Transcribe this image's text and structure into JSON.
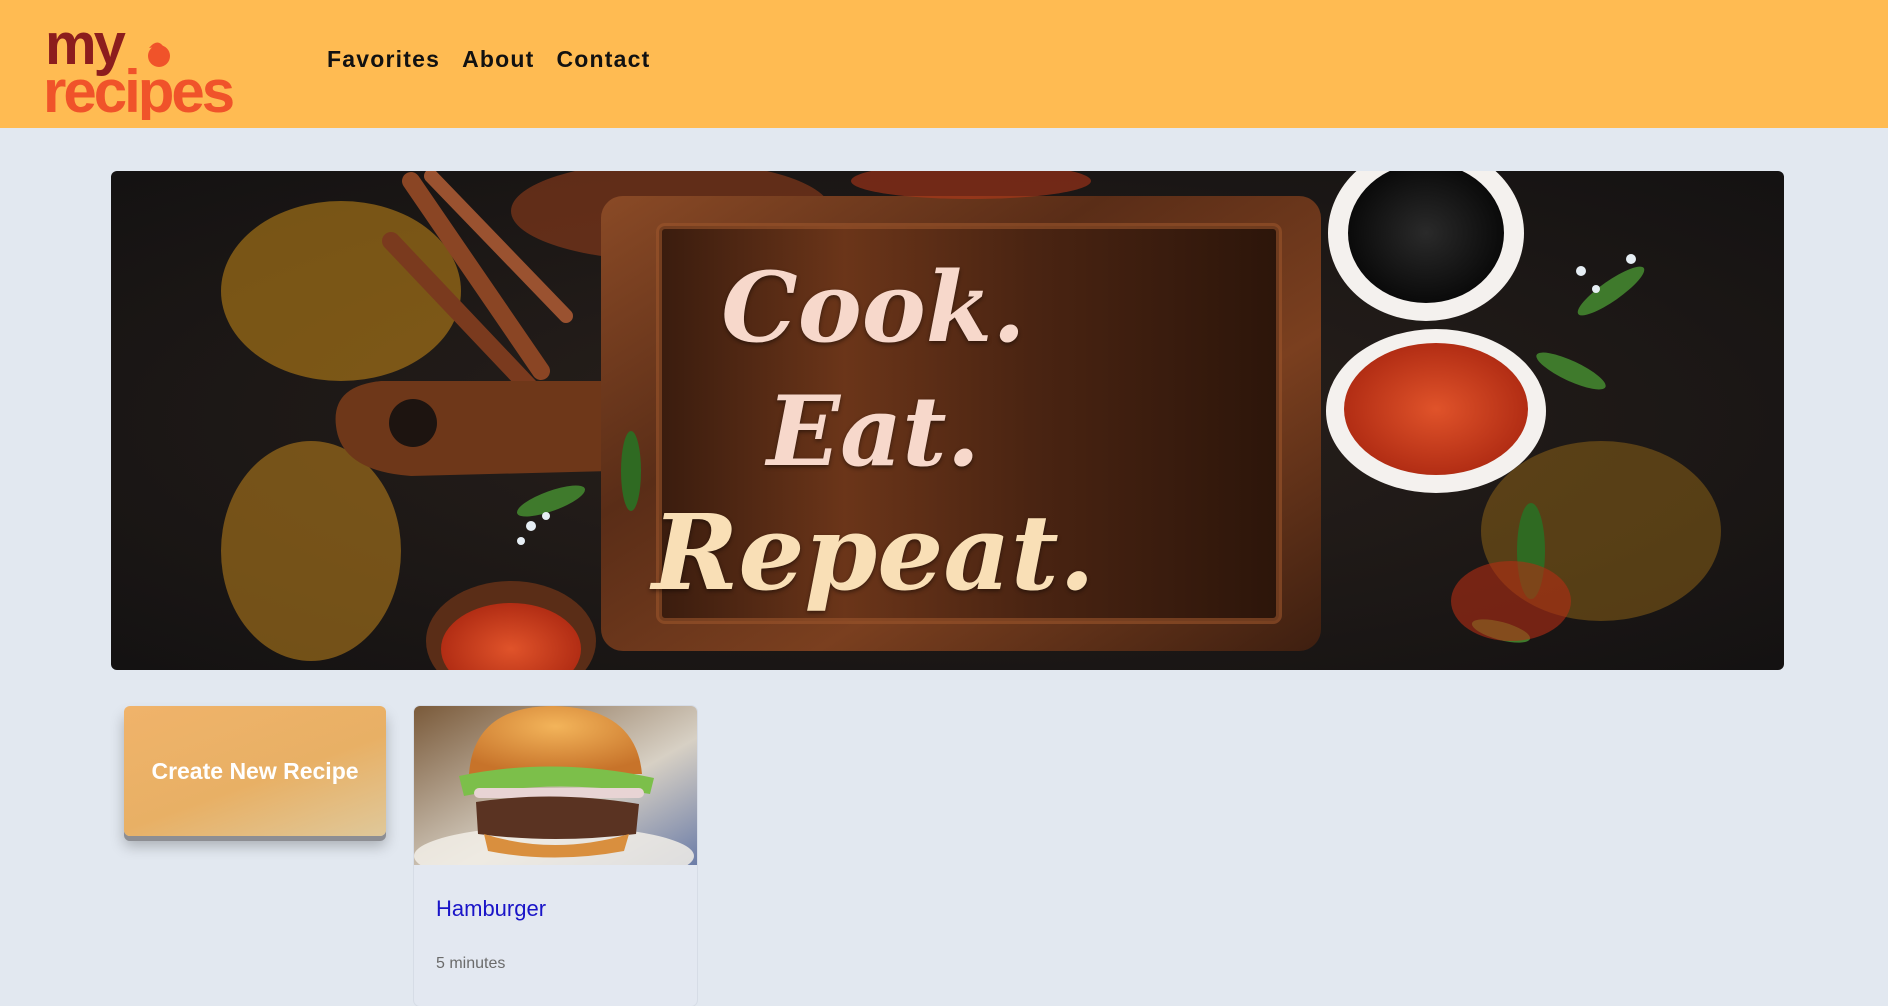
{
  "brand": {
    "logo_line1": "my",
    "logo_line2": "recipes",
    "header_color": "#ffbb52",
    "logo_dark": "#8c1d1d",
    "logo_orange": "#f0532a"
  },
  "nav": {
    "items": [
      {
        "label": "Favorites"
      },
      {
        "label": "About"
      },
      {
        "label": "Contact"
      }
    ]
  },
  "hero": {
    "line1": "Cook.",
    "line2": "Eat.",
    "line3": "Repeat."
  },
  "actions": {
    "create_label": "Create New Recipe"
  },
  "recipes": [
    {
      "title": "Hamburger",
      "time": "5 minutes",
      "image": "hamburger-photo"
    }
  ],
  "colors": {
    "page_bg": "#e2e8f0",
    "link": "#1a14c8",
    "muted": "#6b6b6b"
  }
}
